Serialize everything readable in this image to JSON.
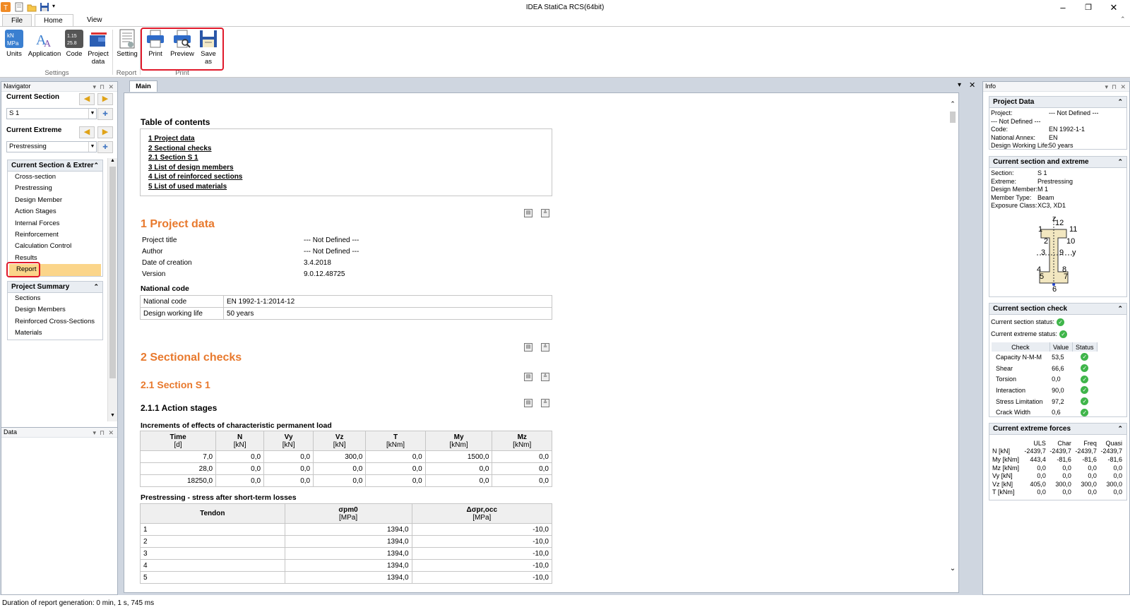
{
  "app": {
    "title": "IDEA StatiCa RCS(64bit)"
  },
  "window": {
    "minimize": "–",
    "restore": "❐",
    "close": "✕",
    "collapse_ribbon": "⌃"
  },
  "tabs": [
    "File",
    "Home",
    "View"
  ],
  "ribbon": {
    "groups": [
      {
        "label": "Settings",
        "buttons": [
          "Units",
          "Application",
          "Code",
          "Project data"
        ]
      },
      {
        "label": "Report",
        "buttons": [
          "Setting"
        ]
      },
      {
        "label": "Print",
        "buttons": [
          "Print",
          "Preview",
          "Save as"
        ]
      }
    ],
    "code_icon_text": "1.15\n25.8"
  },
  "navigator": {
    "title": "Navigator",
    "current_section_label": "Current Section",
    "current_section_value": "S 1",
    "current_extreme_label": "Current Extreme",
    "current_extreme_value": "Prestressing",
    "group1_title": "Current Section & Extrer",
    "group1_items": [
      "Cross-section",
      "Prestressing",
      "Design Member",
      "Action Stages",
      "Internal Forces",
      "Reinforcement",
      "Calculation Control",
      "Results",
      "Report"
    ],
    "group2_title": "Project Summary",
    "group2_items": [
      "Sections",
      "Design Members",
      "Reinforced Cross-Sections",
      "Materials"
    ]
  },
  "data_panel": {
    "title": "Data"
  },
  "main": {
    "tab": "Main"
  },
  "report": {
    "toc_title": "Table of contents",
    "toc": [
      "1 Project data",
      "2 Sectional checks",
      "2.1 Section S 1",
      "3 List of design members",
      "4 List of reinforced sections",
      "5 List of used materials"
    ],
    "project_heading": "1 Project data",
    "project_rows": [
      [
        "Project title",
        "--- Not Defined ---"
      ],
      [
        "Author",
        "--- Not Defined ---"
      ],
      [
        "Date of creation",
        "3.4.2018"
      ],
      [
        "Version",
        "9.0.12.48725"
      ]
    ],
    "national_heading": "National code",
    "national_rows": [
      [
        "National code",
        "EN 1992-1-1:2014-12"
      ],
      [
        "Design working life",
        "50 years"
      ]
    ],
    "sectional_heading": "2 Sectional checks",
    "section_heading": "2.1 Section S 1",
    "action_heading": "2.1.1 Action stages",
    "inc_heading": "Increments of effects of characteristic permanent load",
    "inc_cols": [
      {
        "name": "Time",
        "unit": "[d]"
      },
      {
        "name": "N",
        "unit": "[kN]"
      },
      {
        "name": "Vy",
        "unit": "[kN]"
      },
      {
        "name": "Vz",
        "unit": "[kN]"
      },
      {
        "name": "T",
        "unit": "[kNm]"
      },
      {
        "name": "My",
        "unit": "[kNm]"
      },
      {
        "name": "Mz",
        "unit": "[kNm]"
      }
    ],
    "inc_rows": [
      [
        "7,0",
        "0,0",
        "0,0",
        "300,0",
        "0,0",
        "1500,0",
        "0,0"
      ],
      [
        "28,0",
        "0,0",
        "0,0",
        "0,0",
        "0,0",
        "0,0",
        "0,0"
      ],
      [
        "18250,0",
        "0,0",
        "0,0",
        "0,0",
        "0,0",
        "0,0",
        "0,0"
      ]
    ],
    "pre_heading": "Prestressing - stress after short-term losses",
    "pre_cols": [
      {
        "name": "Tendon",
        "unit": ""
      },
      {
        "name": "σpm0",
        "unit": "[MPa]"
      },
      {
        "name": "Δσpr,occ",
        "unit": "[MPa]"
      }
    ],
    "pre_rows": [
      [
        "1",
        "1394,0",
        "-10,0"
      ],
      [
        "2",
        "1394,0",
        "-10,0"
      ],
      [
        "3",
        "1394,0",
        "-10,0"
      ],
      [
        "4",
        "1394,0",
        "-10,0"
      ],
      [
        "5",
        "1394,0",
        "-10,0"
      ]
    ]
  },
  "info": {
    "title": "Info",
    "project_data_title": "Project Data",
    "project_data": [
      [
        "Project:",
        "--- Not Defined ---"
      ],
      [
        "--- Not Defined ---",
        ""
      ],
      [
        "Code:",
        "EN 1992-1-1"
      ],
      [
        "National Annex:",
        "EN"
      ],
      [
        "Design Working Life:",
        "50 years"
      ]
    ],
    "cse_title": "Current section and extreme",
    "cse": [
      [
        "Section:",
        "S 1"
      ],
      [
        "Extreme:",
        "Prestressing"
      ],
      [
        "Design Member:",
        "M 1"
      ],
      [
        "Member Type:",
        "Beam"
      ],
      [
        "Exposure Class:",
        "XC3, XD1"
      ]
    ],
    "diagram_labels": [
      "z",
      "12",
      "1",
      "11",
      "2",
      "10",
      "3",
      "9",
      "y",
      "4",
      "8",
      "5",
      "7",
      "6"
    ],
    "csc_title": "Current section check",
    "csc_status": [
      "Current section status:",
      "Current extreme status:"
    ],
    "check_cols": [
      "Check",
      "Value",
      "Status"
    ],
    "checks": [
      [
        "Capacity N-M-M",
        "53,5"
      ],
      [
        "Shear",
        "66,6"
      ],
      [
        "Torsion",
        "0,0"
      ],
      [
        "Interaction",
        "90,0"
      ],
      [
        "Stress Limitation",
        "97,2"
      ],
      [
        "Crack Width",
        "0,6"
      ]
    ],
    "cef_title": "Current extreme forces",
    "force_cols": [
      "",
      "ULS",
      "Char",
      "Freq",
      "Quasi"
    ],
    "forces": [
      [
        "N [kN]",
        "-2439,7",
        "-2439,7",
        "-2439,7",
        "-2439,7"
      ],
      [
        "My [kNm]",
        "443,4",
        "-81,6",
        "-81,6",
        "-81,6"
      ],
      [
        "Mz [kNm]",
        "0,0",
        "0,0",
        "0,0",
        "0,0"
      ],
      [
        "Vy [kN]",
        "0,0",
        "0,0",
        "0,0",
        "0,0"
      ],
      [
        "Vz [kN]",
        "405,0",
        "300,0",
        "300,0",
        "300,0"
      ],
      [
        "T [kNm]",
        "0,0",
        "0,0",
        "0,0",
        "0,0"
      ]
    ]
  },
  "status": "Duration of report generation: 0 min, 1 s, 745 ms",
  "colors": {
    "accent_orange": "#e8792d",
    "highlight_red": "#e0192a",
    "ok_green": "#3fb54a",
    "selected": "#fbd58a"
  }
}
